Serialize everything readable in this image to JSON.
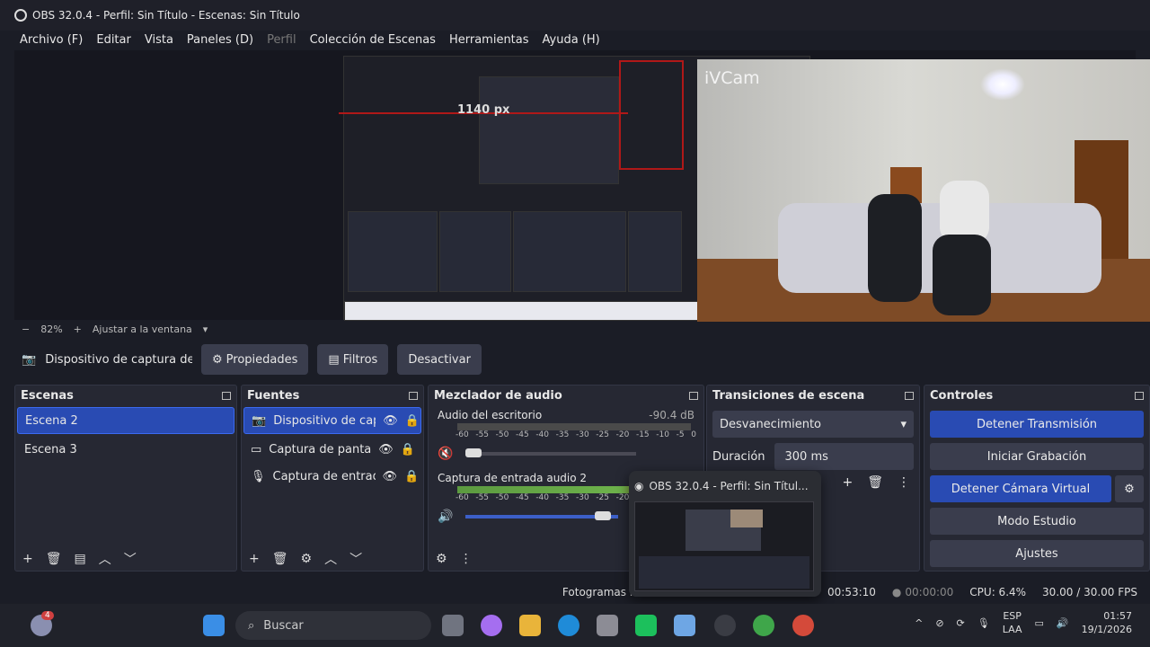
{
  "window": {
    "title": "OBS 32.0.4 - Perfil: Sin Título - Escenas: Sin Título"
  },
  "menu": [
    {
      "label": "Archivo (F)",
      "disabled": false
    },
    {
      "label": "Editar",
      "disabled": false
    },
    {
      "label": "Vista",
      "disabled": false
    },
    {
      "label": "Paneles (D)",
      "disabled": false
    },
    {
      "label": "Perfil",
      "disabled": true
    },
    {
      "label": "Colección de Escenas",
      "disabled": false
    },
    {
      "label": "Herramientas",
      "disabled": false
    },
    {
      "label": "Ayuda (H)",
      "disabled": false
    }
  ],
  "preview": {
    "measure_label": "1140 px",
    "camera_brand": "iVCam"
  },
  "zoom": {
    "minus": "−",
    "level": "82%",
    "plus": "+",
    "fit": "Ajustar a la ventana"
  },
  "source_toolbar": {
    "source_name": "Dispositivo de captura de v",
    "properties": "Propiedades",
    "filters": "Filtros",
    "deactivate": "Desactivar"
  },
  "scenes": {
    "title": "Escenas",
    "items": [
      "Escena 2",
      "Escena 3"
    ],
    "selected": 0
  },
  "sources": {
    "title": "Fuentes",
    "items": [
      {
        "name": "Dispositivo de capt",
        "icon": "camera-icon"
      },
      {
        "name": "Captura de pantalla",
        "icon": "monitor-icon"
      },
      {
        "name": "Captura de entrada",
        "icon": "mic-icon"
      }
    ]
  },
  "mixer": {
    "title": "Mezclador de audio",
    "channels": [
      {
        "name": "Audio del escritorio",
        "db": "-90.4 dB"
      },
      {
        "name": "Captura de entrada audio 2",
        "db": ""
      }
    ],
    "scale": [
      "-60",
      "-55",
      "-50",
      "-45",
      "-40",
      "-35",
      "-30",
      "-25",
      "-20",
      "-15",
      "-10",
      "-5",
      "0"
    ]
  },
  "transitions": {
    "title": "Transiciones de escena",
    "type": "Desvanecimiento",
    "duration_label": "Duración",
    "duration": "300 ms"
  },
  "controls": {
    "title": "Controles",
    "stop_stream": "Detener Transmisión",
    "start_record": "Iniciar Grabación",
    "stop_vcam": "Detener Cámara Virtual",
    "studio": "Modo Estudio",
    "settings": "Ajustes"
  },
  "popup": {
    "title": "OBS 32.0.4 - Perfil: Sin Títul..."
  },
  "status": {
    "fotogramas": "Fotogramas Pe",
    "stream_time": "00:53:10",
    "record_time": "00:00:00",
    "cpu": "CPU: 6.4%",
    "fps": "30.00 / 30.00 FPS"
  },
  "taskbar": {
    "search": "Buscar",
    "notif_badge": "4",
    "lang": "ESP",
    "layout": "LAA",
    "time": "01:57",
    "date": "19/1/2026"
  }
}
